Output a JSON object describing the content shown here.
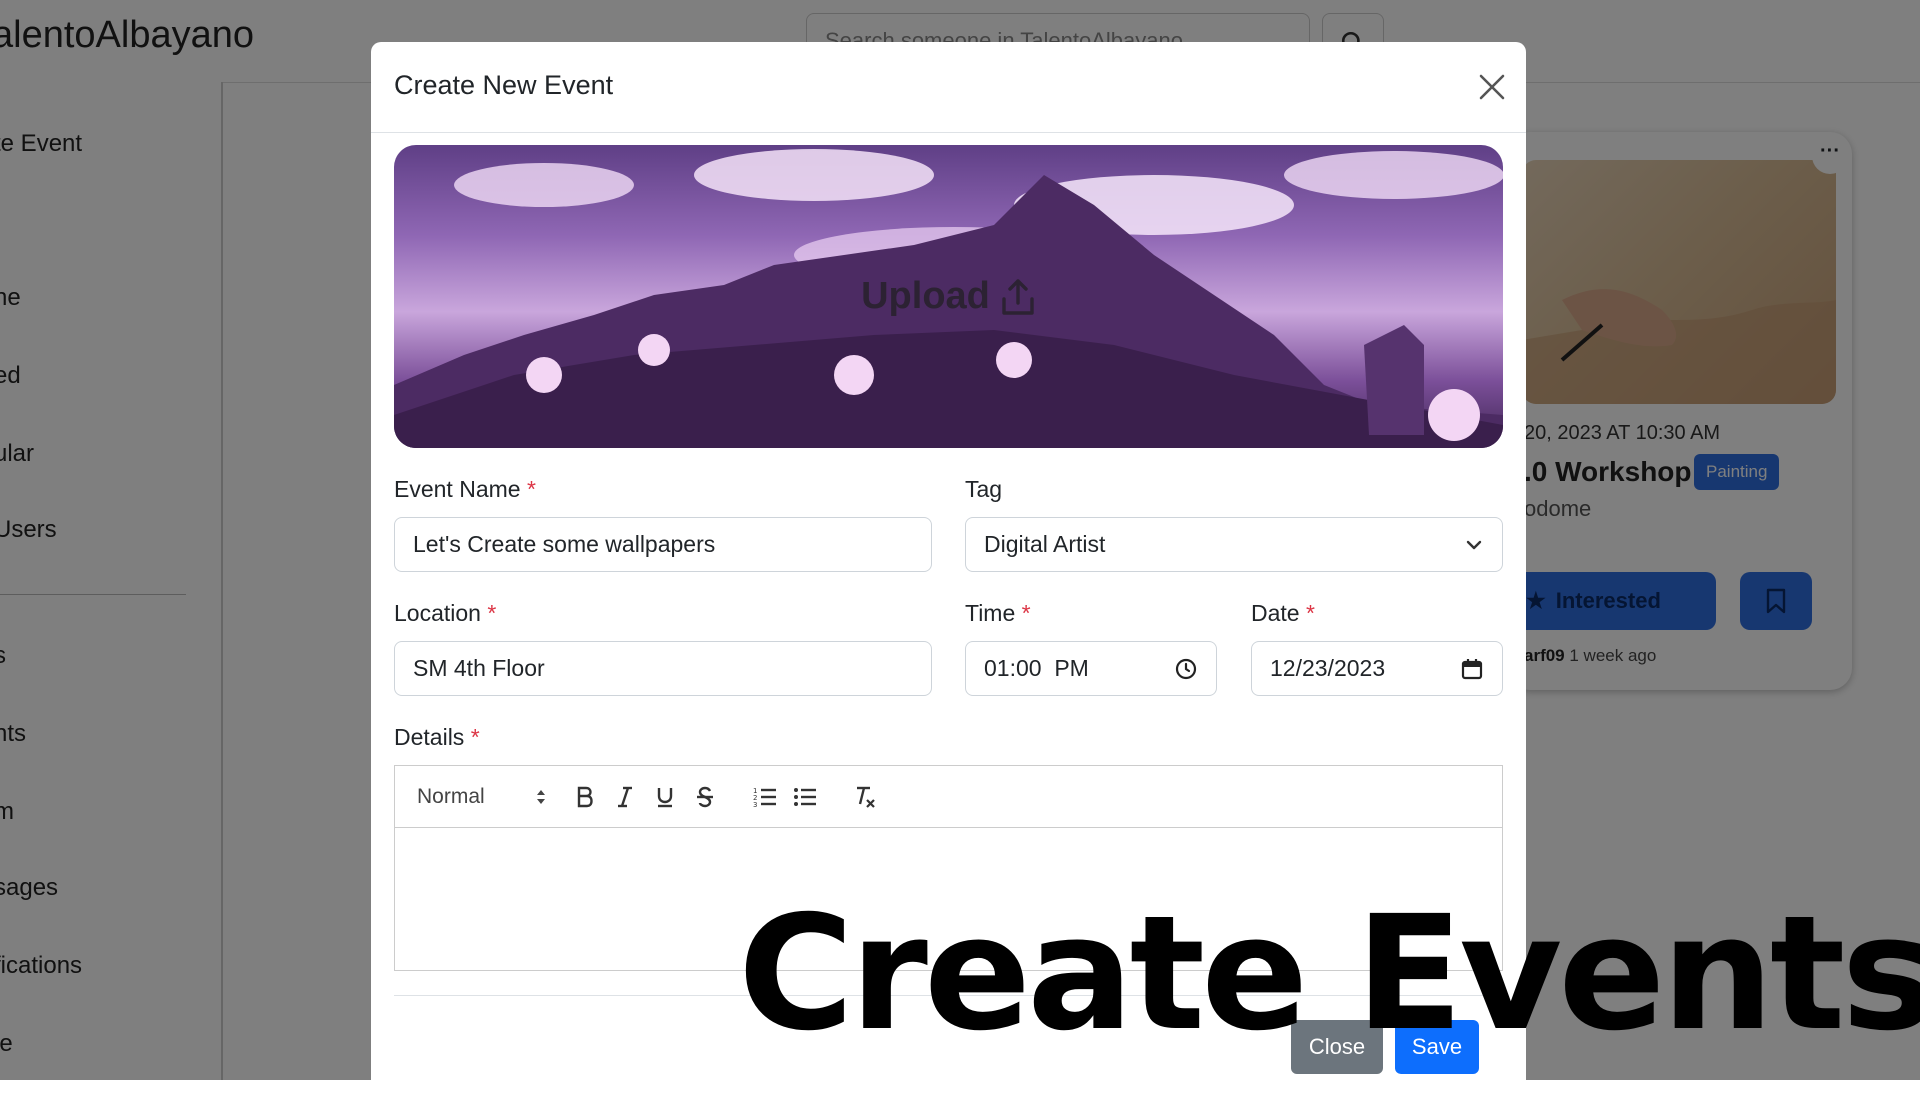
{
  "app": {
    "brand": "alentoAlbayano",
    "search_placeholder": "Search someone in TalentoAlbayano"
  },
  "sidebar": {
    "items": [
      "te Event",
      "ne",
      "ed",
      "ular",
      "Users",
      "s",
      "nts",
      "m",
      "sages",
      "fications",
      "le"
    ]
  },
  "event_card": {
    "date": "20, 2023 AT 10:30 AM",
    "title": ".0 Workshop",
    "tag": "Painting",
    "host": "odome",
    "interested_label": "Interested",
    "author": "arf09",
    "time_ago": "1 week ago"
  },
  "modal": {
    "title": "Create New Event",
    "upload_label": "Upload",
    "fields": {
      "event_name": {
        "label": "Event Name",
        "value": "Let's Create some wallpapers"
      },
      "tag": {
        "label": "Tag",
        "value": "Digital Artist"
      },
      "location": {
        "label": "Location",
        "value": "SM 4th Floor"
      },
      "time": {
        "label": "Time",
        "value": "01:00  PM"
      },
      "date": {
        "label": "Date",
        "value": "12/23/2023"
      },
      "details": {
        "label": "Details",
        "value": ""
      }
    },
    "required_mark": "*",
    "editor": {
      "format": "Normal"
    },
    "buttons": {
      "close": "Close",
      "save": "Save"
    }
  },
  "overlay_caption": "Create Events",
  "colors": {
    "primary": "#0d6efd",
    "secondary": "#6c757d",
    "required": "#dc3545",
    "tag_badge": "#2f6fe0"
  }
}
